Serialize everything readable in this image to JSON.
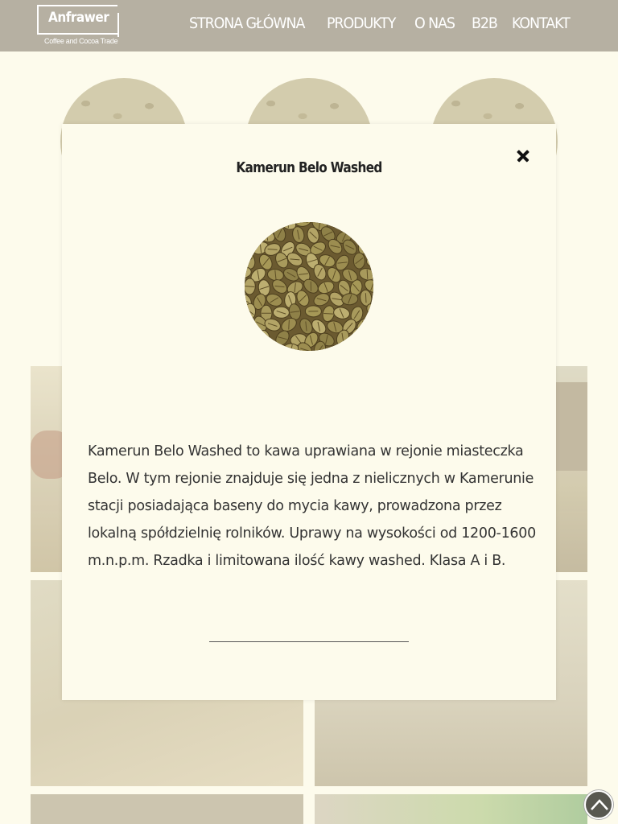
{
  "header": {
    "logo_name": "Anfrawer",
    "logo_tagline": "Coffee and Cocoa Trade",
    "nav": [
      {
        "label": "STRONA GŁÓWNA"
      },
      {
        "label": "PRODUKTY"
      },
      {
        "label": "O NAS"
      },
      {
        "label": "B2B"
      },
      {
        "label": "KONTAKT"
      }
    ]
  },
  "modal": {
    "title": "Kamerun Belo Washed",
    "close_icon": "close-icon",
    "image_alt": "green coffee beans",
    "description": "Kamerun Belo Washed to kawa uprawiana w rejonie miasteczka Belo. W tym rejonie znajduje się jedna z nielicznych w Kamerunie stacji posiadająca baseny do mycia kawy, prowadzona przez lokalną spółdzielnię rolników. Uprawy na wysokości od 1200-1600 m.n.p.m. Rzadka i limitowana ilość kawy washed. Klasa A i B."
  },
  "scroll_top": {
    "icon": "chevron-up-icon"
  },
  "colors": {
    "header_bg": "#b6b0a2",
    "page_bg": "#fdfbec",
    "text": "#333333"
  }
}
